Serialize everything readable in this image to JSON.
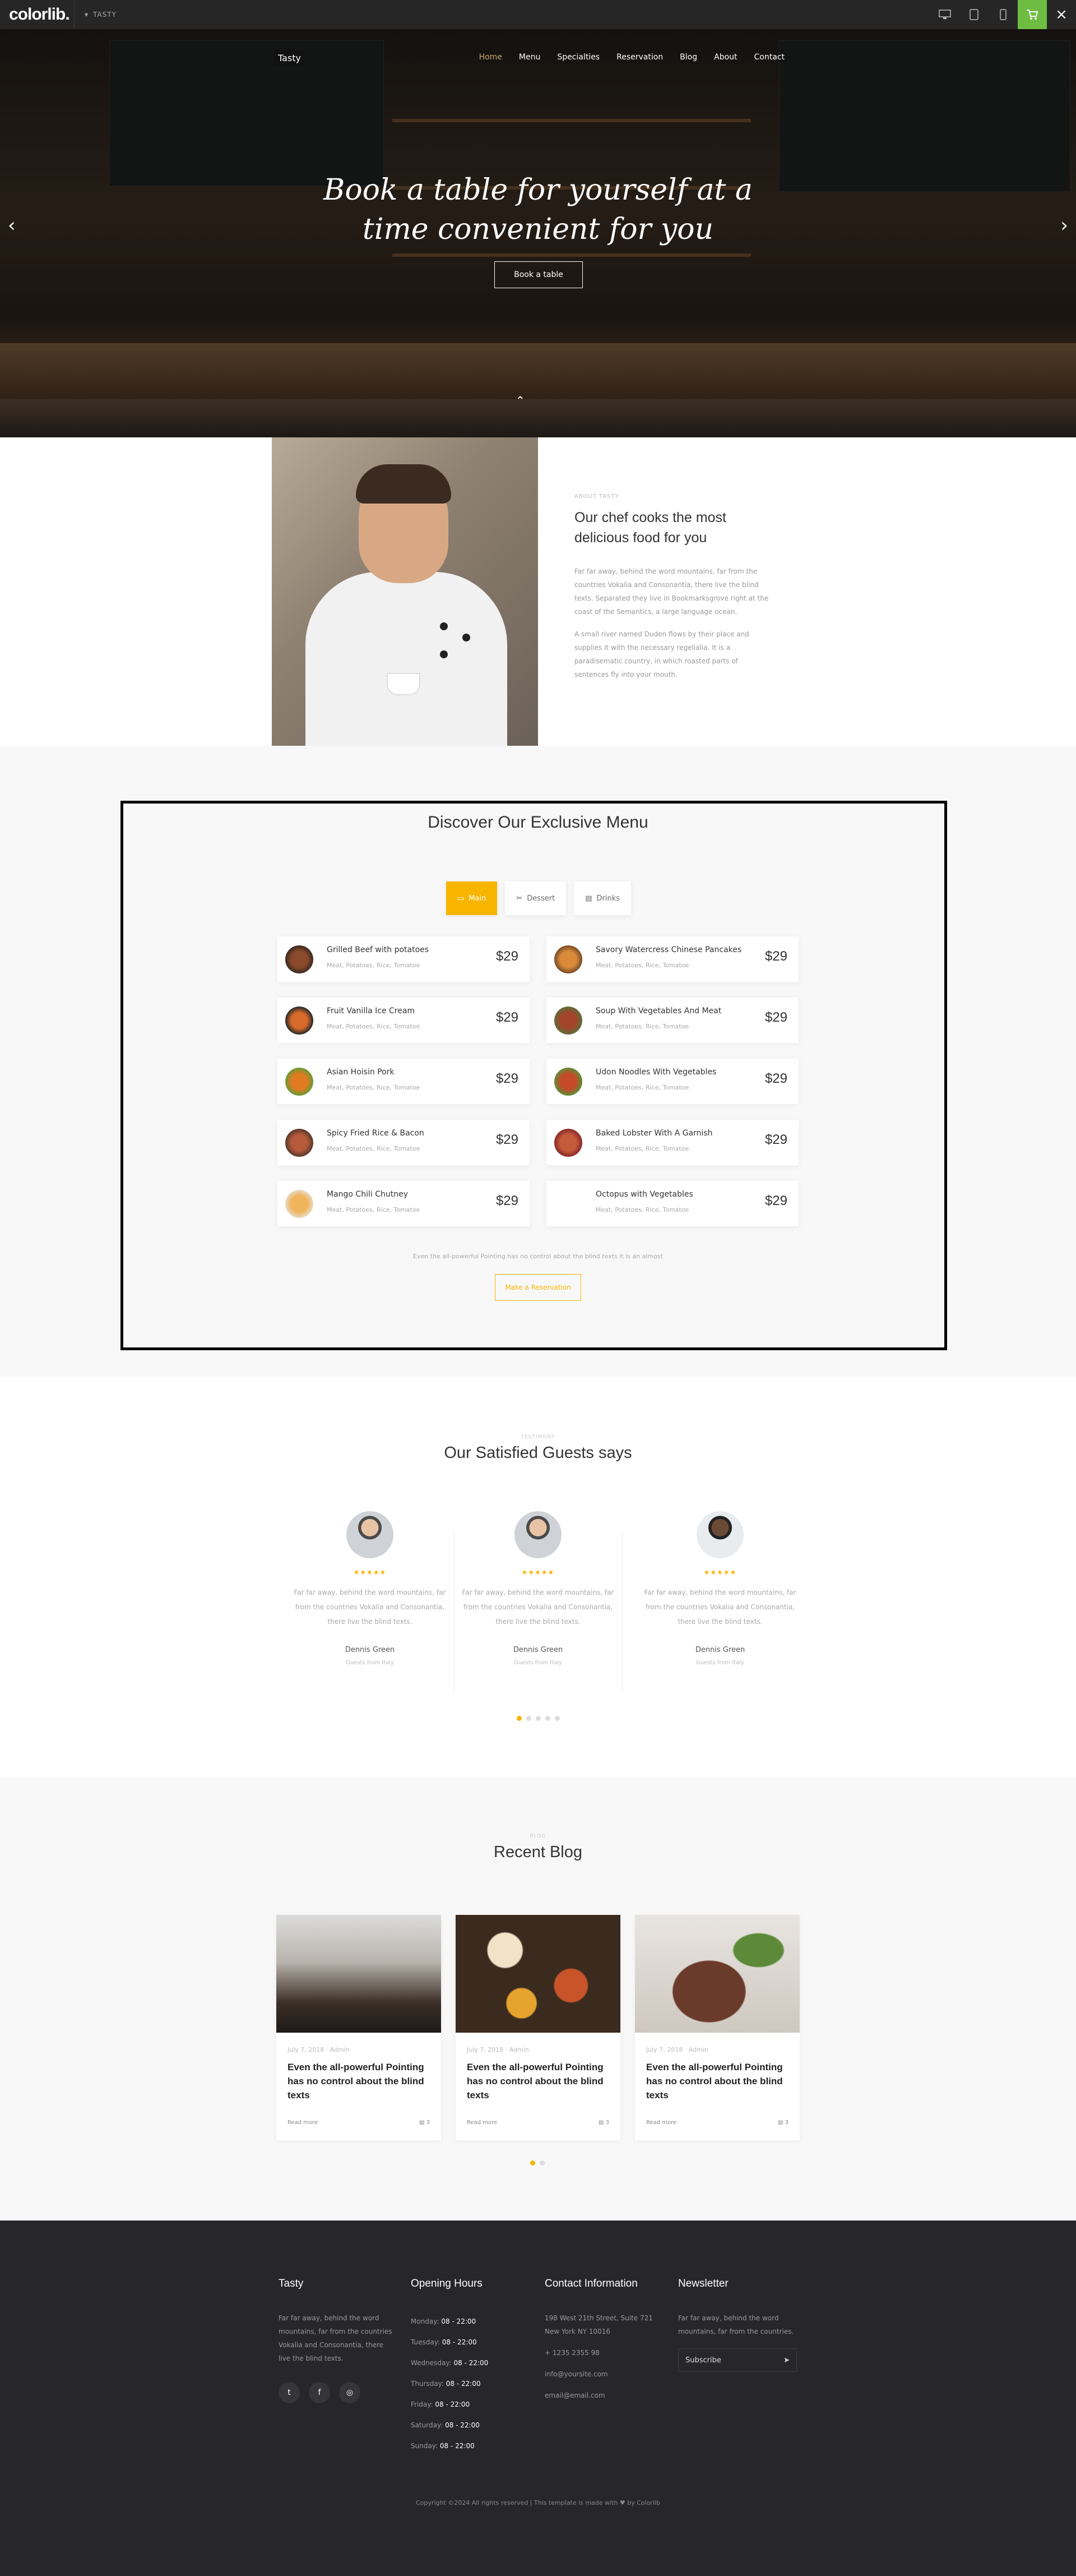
{
  "topbar": {
    "brand": "colorlib.",
    "theme_label": "TASTY",
    "device_icons": [
      "desktop-icon",
      "tablet-icon",
      "mobile-icon"
    ],
    "cart_color": "#6ebd42",
    "close_glyph": "×"
  },
  "header": {
    "logo": "Tasty",
    "nav": [
      "Home",
      "Menu",
      "Specialties",
      "Reservation",
      "Blog",
      "About",
      "Contact"
    ],
    "active_nav": "Home"
  },
  "hero": {
    "title_line1": "Book a table for yourself at a",
    "title_line2": "time convenient for you",
    "button": "Book a table"
  },
  "about": {
    "subheading": "ABOUT TASTY",
    "title": "Our chef cooks the most delicious food for you",
    "para1": "Far far away, behind the word mountains, far from the countries Vokalia and Consonantia, there live the blind texts. Separated they live in Bookmarksgrove right at the coast of the Semantics, a large language ocean.",
    "para2": "A small river named Duden flows by their place and supplies it with the necessary regelialia. It is a paradisematic country, in which roasted parts of sentences fly into your mouth."
  },
  "menu": {
    "title": "Discover Our Exclusive Menu",
    "tabs": [
      "Main",
      "Dessert",
      "Drinks"
    ],
    "active_tab": "Main",
    "items": [
      {
        "name": "Grilled Beef with potatoes",
        "desc": "Meat, Potatoes, Rice, Tomatoe",
        "price": "$29"
      },
      {
        "name": "Savory Watercress Chinese Pancakes",
        "desc": "Meat, Potatoes, Rice, Tomatoe",
        "price": "$29"
      },
      {
        "name": "Fruit Vanilla Ice Cream",
        "desc": "Meat, Potatoes, Rice, Tomatoe",
        "price": "$29"
      },
      {
        "name": "Soup With Vegetables And Meat",
        "desc": "Meat, Potatoes, Rice, Tomatoe",
        "price": "$29"
      },
      {
        "name": "Asian Hoisin Pork",
        "desc": "Meat, Potatoes, Rice, Tomatoe",
        "price": "$29"
      },
      {
        "name": "Udon Noodles With Vegetables",
        "desc": "Meat, Potatoes, Rice, Tomatoe",
        "price": "$29"
      },
      {
        "name": "Spicy Fried Rice & Bacon",
        "desc": "Meat, Potatoes, Rice, Tomatoe",
        "price": "$29"
      },
      {
        "name": "Baked Lobster With A Garnish",
        "desc": "Meat, Potatoes, Rice, Tomatoe",
        "price": "$29"
      },
      {
        "name": "Mango Chili Chutney",
        "desc": "Meat, Potatoes, Rice, Tomatoe",
        "price": "$29"
      },
      {
        "name": "Octopus with Vegetables",
        "desc": "Meat, Potatoes, Rice, Tomatoe",
        "price": "$29"
      }
    ],
    "note": "Even the all-powerful Pointing has no control about the blind texts it is an almost",
    "reservation_button": "Make a Reservation",
    "accent": "#f7b500"
  },
  "testimonials": {
    "subheading": "TESTIMONY",
    "title": "Our Satisfied Guests says",
    "items": [
      {
        "stars": "★★★★★",
        "quote": "Far far away, behind the word mountains, far from the countries Vokalia and Consonantia, there live the blind texts.",
        "name": "Dennis Green",
        "role": "Guests from Italy"
      },
      {
        "stars": "★★★★★",
        "quote": "Far far away, behind the word mountains, far from the countries Vokalia and Consonantia, there live the blind texts.",
        "name": "Dennis Green",
        "role": "Guests from Italy"
      },
      {
        "stars": "★★★★★",
        "quote": "Far far away, behind the word mountains, far from the countries Vokalia and Consonantia, there live the blind texts.",
        "name": "Dennis Green",
        "role": "Guests from Italy"
      }
    ]
  },
  "blog": {
    "subheading": "BLOG",
    "title": "Recent Blog",
    "posts": [
      {
        "meta": "July 7, 2018 · Admin",
        "title": "Even the all-powerful Pointing has no control about the blind texts",
        "read": "Read more",
        "comments": "3"
      },
      {
        "meta": "July 7, 2018 · Admin",
        "title": "Even the all-powerful Pointing has no control about the blind texts",
        "read": "Read more",
        "comments": "3"
      },
      {
        "meta": "July 7, 2018 · Admin",
        "title": "Even the all-powerful Pointing has no control about the blind texts",
        "read": "Read more",
        "comments": "3"
      }
    ]
  },
  "footer": {
    "about_title": "Tasty",
    "about_text": "Far far away, behind the word mountains, far from the countries Vokalia and Consonantia, there live the blind texts.",
    "hours_title": "Opening Hours",
    "hours": [
      {
        "day": "Monday:",
        "time": "08 - 22:00"
      },
      {
        "day": "Tuesday:",
        "time": "08 - 22:00"
      },
      {
        "day": "Wednesday:",
        "time": "08 - 22:00"
      },
      {
        "day": "Thursday:",
        "time": "08 - 22:00"
      },
      {
        "day": "Friday:",
        "time": "08 - 22:00"
      },
      {
        "day": "Saturday:",
        "time": "08 - 22:00"
      },
      {
        "day": "Sunday:",
        "time": "08 - 22:00"
      }
    ],
    "contact_title": "Contact Information",
    "address": "198 West 21th Street, Suite 721 New York NY 10016",
    "phone": "+ 1235 2355 98",
    "email1": "info@yoursite.com",
    "email2": "email@email.com",
    "newsletter_title": "Newsletter",
    "newsletter_text": "Far far away, behind the word mountains, far from the countries.",
    "subscribe_placeholder": "Subscribe",
    "copyright": "Copyright ©2024 All rights reserved | This template is made with ♥ by Colorlib"
  }
}
